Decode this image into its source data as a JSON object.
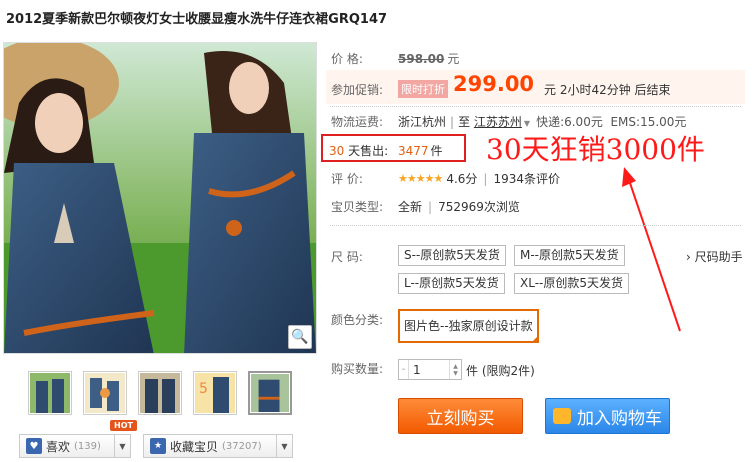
{
  "product": {
    "title": "2012夏季新款巴尔顿夜灯女士收腰显瘦水洗牛仔连衣裙GRQ147"
  },
  "price": {
    "label": "价    格:",
    "original": "598.00",
    "unit": "元"
  },
  "promo": {
    "label": "参加促销:",
    "tag": "限时打折",
    "price": "299.00",
    "tail": "元 2小时42分钟 后结束"
  },
  "shipping": {
    "label": "物流运费:",
    "from": "浙江杭州",
    "to": "江苏苏州",
    "express": "快递:6.00元",
    "ems": "EMS:15.00元"
  },
  "sold": {
    "label_num": "30",
    "label_text": "天售出:",
    "value": "3477",
    "unit": "件"
  },
  "annotation": {
    "text": "30天狂销3000件",
    "color": "#ff1a1a"
  },
  "rating": {
    "label": "评    价:",
    "stars": "★★★★★",
    "score": "4.6分",
    "count": "1934条评价"
  },
  "type": {
    "label": "宝贝类型:",
    "value": "全新",
    "views": "752969次浏览"
  },
  "size": {
    "label": "尺    码:",
    "options": [
      "S--原创款5天发货",
      "M--原创款5天发货",
      "L--原创款5天发货",
      "XL--原创款5天发货"
    ],
    "help": "› 尺码助手"
  },
  "color": {
    "label": "颜色分类:",
    "selected": "图片色--独家原创设计款",
    "accent": "#e36a00"
  },
  "quantity": {
    "label": "购买数量:",
    "value": "1",
    "tail": "件 (限购2件)"
  },
  "actions": {
    "buy": "立刻购买",
    "cart": "加入购物车",
    "buy_color": "#f25a00",
    "cart_color": "#2a86e8"
  },
  "social": {
    "like_label": "喜欢",
    "like_count": "(139)",
    "hot": "HOT",
    "fav_label": "收藏宝贝",
    "fav_count": "(37207)"
  },
  "icons": {
    "zoom": "magnifier-icon",
    "heart": "heart-icon",
    "fav": "star-folder-icon",
    "cart": "shopping-cart-icon"
  }
}
